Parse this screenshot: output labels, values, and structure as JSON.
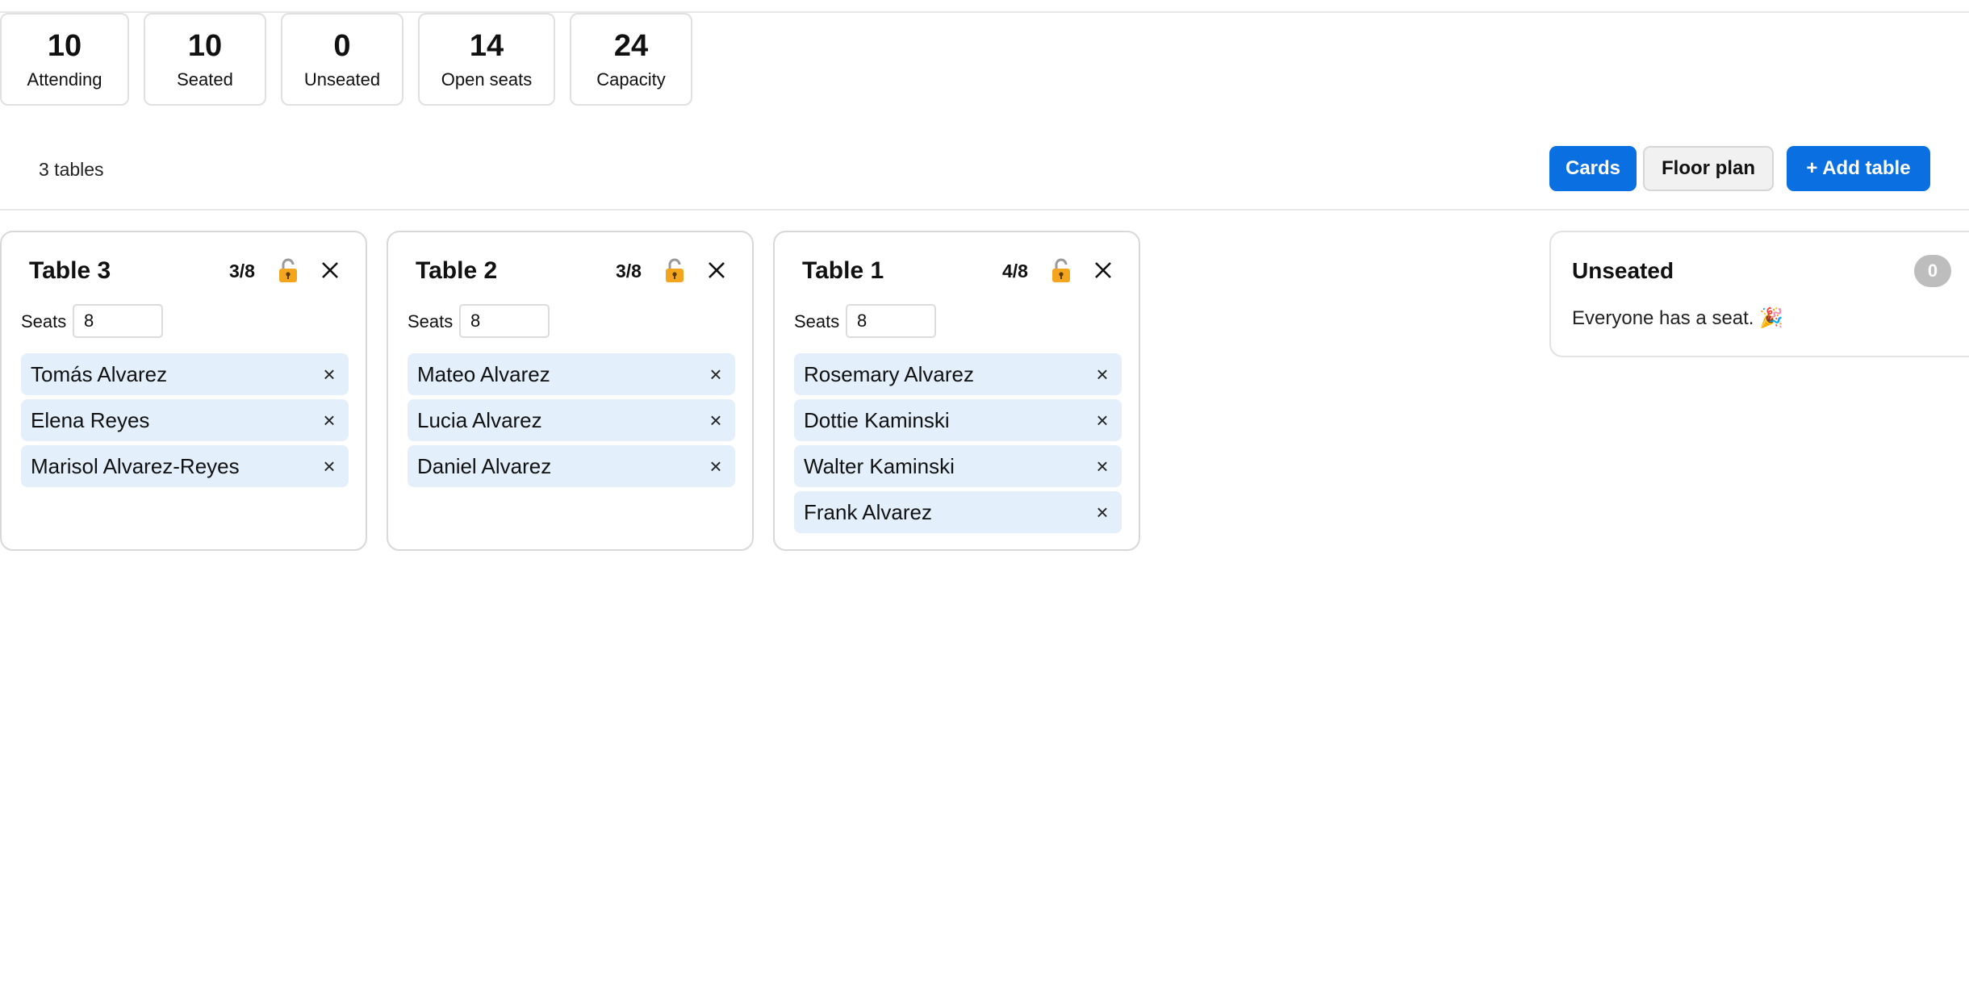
{
  "stats": [
    {
      "value": "10",
      "label": "Attending"
    },
    {
      "value": "10",
      "label": "Seated"
    },
    {
      "value": "0",
      "label": "Unseated"
    },
    {
      "value": "14",
      "label": "Open seats"
    },
    {
      "value": "24",
      "label": "Capacity"
    }
  ],
  "toolbar": {
    "table_count": "3 tables",
    "cards_label": "Cards",
    "floor_plan_label": "Floor plan",
    "add_table_label": "+ Add table"
  },
  "tables": [
    {
      "name": "Table 3",
      "count": "3/8",
      "seats_label": "Seats",
      "seats_value": "8",
      "guests": [
        "Tomás Alvarez",
        "Elena Reyes",
        "Marisol Alvarez-Reyes"
      ]
    },
    {
      "name": "Table 2",
      "count": "3/8",
      "seats_label": "Seats",
      "seats_value": "8",
      "guests": [
        "Mateo Alvarez",
        "Lucia Alvarez",
        "Daniel Alvarez"
      ]
    },
    {
      "name": "Table 1",
      "count": "4/8",
      "seats_label": "Seats",
      "seats_value": "8",
      "guests": [
        "Rosemary Alvarez",
        "Dottie Kaminski",
        "Walter Kaminski",
        "Frank Alvarez"
      ]
    }
  ],
  "guest_remove_glyph": "×",
  "unseated": {
    "title": "Unseated",
    "count": "0",
    "message": "Everyone has a seat. 🎉"
  },
  "icons": {
    "lock": "lock-open-icon",
    "close": "close-icon",
    "remove_guest": "remove-guest-icon"
  },
  "colors": {
    "primary": "#0a6fe0",
    "guest_chip": "#e3effb",
    "badge": "#bdbdbd",
    "lock_body": "#f2a51d"
  }
}
